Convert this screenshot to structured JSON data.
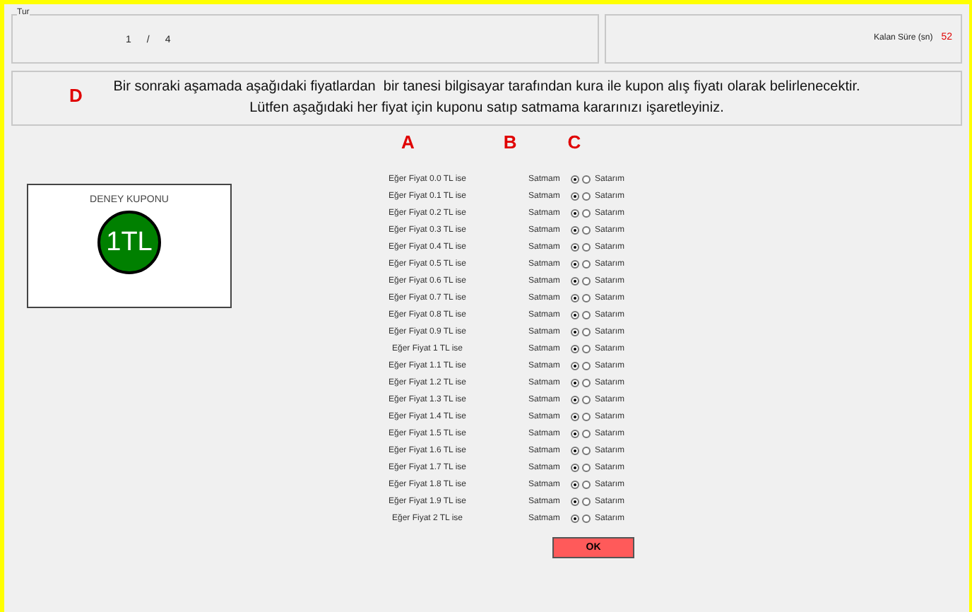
{
  "round_panel": {
    "legend": "Tur",
    "current": "1",
    "separator": "/",
    "total": "4"
  },
  "timer_panel": {
    "label": "Kalan Süre (sn)",
    "value": "52"
  },
  "instructions": {
    "lines": [
      "Bir sonraki aşamada aşağıdaki fiyatlardan  bir tanesi bilgisayar tarafından kura ile kupon alış fiyatı olarak belirlenecektir.",
      "Lütfen aşağıdaki her fiyat için kuponu satıp satmama kararınızı işaretleyiniz."
    ]
  },
  "annotations": {
    "a": "A",
    "b": "B",
    "c": "C",
    "d": "D"
  },
  "coupon": {
    "title": "DENEY KUPONU",
    "value": "1TL"
  },
  "rows": [
    {
      "label": "Eğer Fiyat 0.0 TL ise",
      "no_label": "Satmam",
      "yes_label": "Satarım",
      "options": [
        {
          "selected": true
        },
        {
          "selected": false
        }
      ]
    },
    {
      "label": "Eğer Fiyat 0.1 TL ise",
      "no_label": "Satmam",
      "yes_label": "Satarım",
      "options": [
        {
          "selected": true
        },
        {
          "selected": false
        }
      ]
    },
    {
      "label": "Eğer Fiyat 0.2 TL ise",
      "no_label": "Satmam",
      "yes_label": "Satarım",
      "options": [
        {
          "selected": true
        },
        {
          "selected": false
        }
      ]
    },
    {
      "label": "Eğer Fiyat 0.3 TL ise",
      "no_label": "Satmam",
      "yes_label": "Satarım",
      "options": [
        {
          "selected": true
        },
        {
          "selected": false
        }
      ]
    },
    {
      "label": "Eğer Fiyat 0.4 TL ise",
      "no_label": "Satmam",
      "yes_label": "Satarım",
      "options": [
        {
          "selected": true
        },
        {
          "selected": false
        }
      ]
    },
    {
      "label": "Eğer Fiyat 0.5 TL ise",
      "no_label": "Satmam",
      "yes_label": "Satarım",
      "options": [
        {
          "selected": true
        },
        {
          "selected": false
        }
      ]
    },
    {
      "label": "Eğer Fiyat 0.6 TL ise",
      "no_label": "Satmam",
      "yes_label": "Satarım",
      "options": [
        {
          "selected": true
        },
        {
          "selected": false
        }
      ]
    },
    {
      "label": "Eğer Fiyat 0.7 TL ise",
      "no_label": "Satmam",
      "yes_label": "Satarım",
      "options": [
        {
          "selected": true
        },
        {
          "selected": false
        }
      ]
    },
    {
      "label": "Eğer Fiyat 0.8 TL ise",
      "no_label": "Satmam",
      "yes_label": "Satarım",
      "options": [
        {
          "selected": true
        },
        {
          "selected": false
        }
      ]
    },
    {
      "label": "Eğer Fiyat 0.9 TL ise",
      "no_label": "Satmam",
      "yes_label": "Satarım",
      "options": [
        {
          "selected": true
        },
        {
          "selected": false
        }
      ]
    },
    {
      "label": "Eğer Fiyat 1 TL ise",
      "no_label": "Satmam",
      "yes_label": "Satarım",
      "options": [
        {
          "selected": true
        },
        {
          "selected": false
        }
      ]
    },
    {
      "label": "Eğer Fiyat 1.1 TL ise",
      "no_label": "Satmam",
      "yes_label": "Satarım",
      "options": [
        {
          "selected": true
        },
        {
          "selected": false
        }
      ]
    },
    {
      "label": "Eğer Fiyat 1.2 TL ise",
      "no_label": "Satmam",
      "yes_label": "Satarım",
      "options": [
        {
          "selected": true
        },
        {
          "selected": false
        }
      ]
    },
    {
      "label": "Eğer Fiyat 1.3 TL ise",
      "no_label": "Satmam",
      "yes_label": "Satarım",
      "options": [
        {
          "selected": true
        },
        {
          "selected": false
        }
      ]
    },
    {
      "label": "Eğer Fiyat 1.4 TL ise",
      "no_label": "Satmam",
      "yes_label": "Satarım",
      "options": [
        {
          "selected": true
        },
        {
          "selected": false
        }
      ]
    },
    {
      "label": "Eğer Fiyat 1.5 TL ise",
      "no_label": "Satmam",
      "yes_label": "Satarım",
      "options": [
        {
          "selected": true
        },
        {
          "selected": false
        }
      ]
    },
    {
      "label": "Eğer Fiyat 1.6 TL ise",
      "no_label": "Satmam",
      "yes_label": "Satarım",
      "options": [
        {
          "selected": true
        },
        {
          "selected": false
        }
      ]
    },
    {
      "label": "Eğer Fiyat 1.7 TL ise",
      "no_label": "Satmam",
      "yes_label": "Satarım",
      "options": [
        {
          "selected": true
        },
        {
          "selected": false
        }
      ]
    },
    {
      "label": "Eğer Fiyat 1.8 TL ise",
      "no_label": "Satmam",
      "yes_label": "Satarım",
      "options": [
        {
          "selected": true
        },
        {
          "selected": false
        }
      ]
    },
    {
      "label": "Eğer Fiyat 1.9 TL ise",
      "no_label": "Satmam",
      "yes_label": "Satarım",
      "options": [
        {
          "selected": true
        },
        {
          "selected": false
        }
      ]
    },
    {
      "label": "Eğer Fiyat 2 TL ise",
      "no_label": "Satmam",
      "yes_label": "Satarım",
      "options": [
        {
          "selected": true
        },
        {
          "selected": false
        }
      ]
    }
  ],
  "ok_button": "OK"
}
